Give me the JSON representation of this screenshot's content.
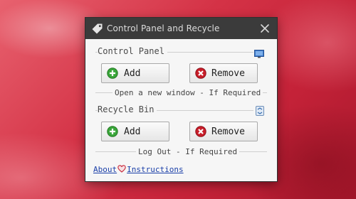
{
  "window": {
    "title": "Control Panel and Recycle",
    "title_icon": "tag-icon",
    "close_icon": "close-icon"
  },
  "control_panel": {
    "label": "Control Panel",
    "icon": "monitor-icon",
    "add_label": "Add",
    "remove_label": "Remove",
    "hint": "Open a new window - If Required"
  },
  "recycle_bin": {
    "label": "Recycle Bin",
    "icon": "recycle-bin-icon",
    "add_label": "Add",
    "remove_label": "Remove",
    "hint": "Log Out - If Required"
  },
  "footer": {
    "about_label": "About",
    "instructions_label": "Instructions",
    "heart_icon": "heart-icon"
  },
  "colors": {
    "titlebar": "#3b3b3b",
    "panel": "#f6f6f6",
    "add_icon": "#3aa63a",
    "remove_icon": "#c81e2a",
    "link": "#1a3fa8"
  }
}
